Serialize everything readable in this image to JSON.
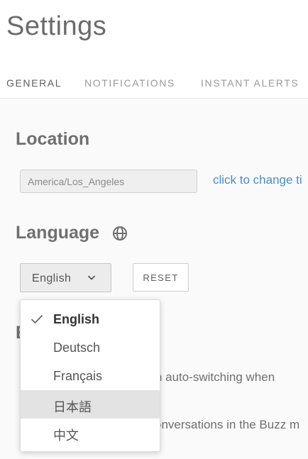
{
  "page": {
    "title": "Settings"
  },
  "tabs": [
    {
      "label": "GENERAL"
    },
    {
      "label": "NOTIFICATIONS"
    },
    {
      "label": "INSTANT ALERTS"
    }
  ],
  "location": {
    "heading": "Location",
    "timezone_value": "America/Los_Angeles",
    "change_link": "click to change ti"
  },
  "language": {
    "heading": "Language",
    "selected": "English",
    "reset_label": "RESET",
    "options": [
      {
        "label": "English"
      },
      {
        "label": "Deutsch"
      },
      {
        "label": "Français"
      },
      {
        "label": "日本語"
      },
      {
        "label": "中文"
      }
    ]
  },
  "behind": {
    "heading_fragment": "E",
    "text_1": "tion auto-switching when",
    "text_2": "onversations in the Buzz m"
  },
  "colors": {
    "accent_link": "#4a8ec2",
    "hover_row": "#e3e3e3",
    "title_text": "#6b6b6b"
  }
}
